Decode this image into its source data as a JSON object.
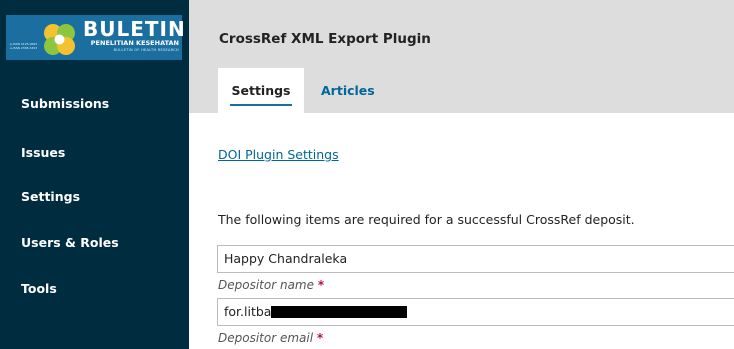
{
  "sidebar": {
    "logo": {
      "title": "BULETIN",
      "subtitle": "PENELITIAN KESEHATAN",
      "tagline": "BULLETIN OF HEALTH RESEARCH",
      "issn_print": "p-ISSN 0125-9695",
      "issn_online": "e-ISSN 2338-3453"
    },
    "items": [
      {
        "label": "Submissions"
      },
      {
        "label": "Issues"
      },
      {
        "label": "Settings"
      },
      {
        "label": "Users & Roles"
      },
      {
        "label": "Tools"
      }
    ]
  },
  "header": {
    "title": "CrossRef XML Export Plugin",
    "tabs": [
      {
        "label": "Settings",
        "active": true
      },
      {
        "label": "Articles",
        "active": false
      }
    ]
  },
  "main": {
    "doi_link": "DOI Plugin Settings",
    "intro": "The following items are required for a successful CrossRef deposit.",
    "fields": [
      {
        "value": "Happy Chandraleka",
        "label": "Depositor name",
        "required_mark": "*"
      },
      {
        "value": "for.litba",
        "label": "Depositor email",
        "required_mark": "*"
      }
    ]
  },
  "colors": {
    "sidebar_bg": "#002c40",
    "header_bg": "#dddddd",
    "link": "#006798",
    "required": "#b40e4e",
    "logo_bg": "#1b6fa0"
  }
}
